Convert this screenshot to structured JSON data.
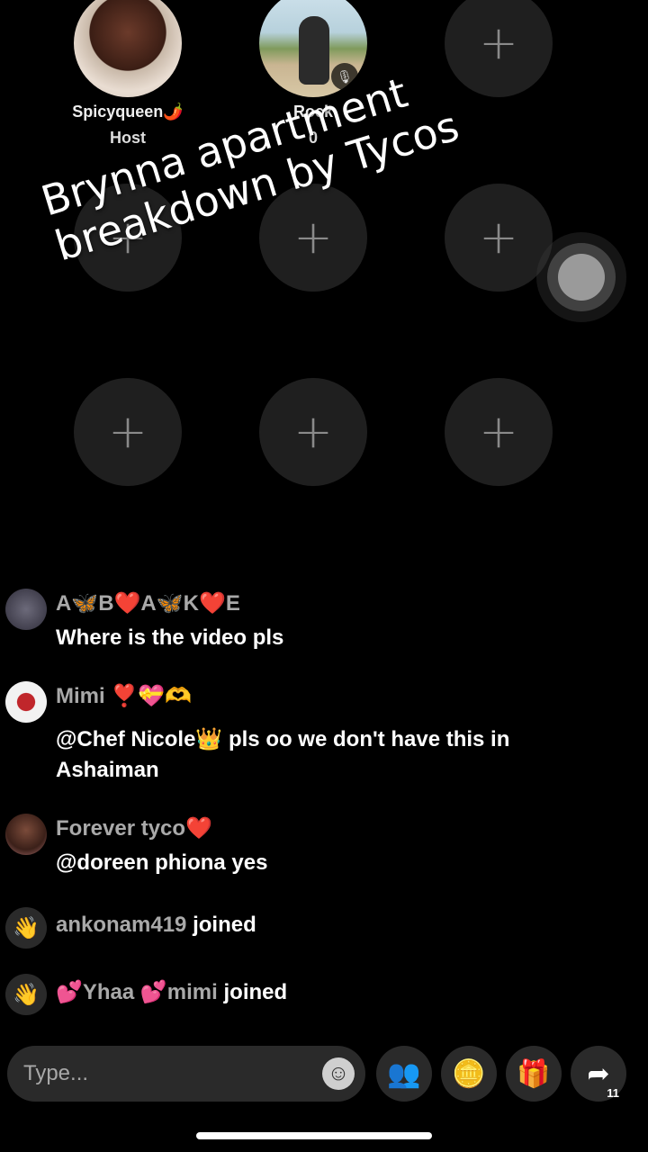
{
  "seats": {
    "seat1": {
      "name": "Spicyqueen🌶️",
      "role": "Host"
    },
    "seat2": {
      "name": "Rock",
      "sub": "0"
    },
    "empty_icon": "+"
  },
  "overlay": {
    "line1": "Brynna apartment",
    "line2": "breakdown by Tycos"
  },
  "chat": [
    {
      "user": "A🦋B❤️A🦋K❤️E",
      "text": "Where is the video pls"
    },
    {
      "user": "Mimi ❣️💝🫶",
      "text": "@Chef Nicole👑 pls oo we don't have this in Ashaiman"
    },
    {
      "user": "Forever tyco❤️",
      "text": "@doreen phiona yes"
    }
  ],
  "joins": [
    {
      "user": "ankonam419",
      "action": "joined"
    },
    {
      "user": "💕Yhaa 💕mimi",
      "action": "joined"
    }
  ],
  "input": {
    "placeholder": "Type..."
  },
  "share_count": "11",
  "colors": {
    "background": "#000000",
    "seat": "#1f1f1f",
    "input": "#2a2a2a"
  }
}
